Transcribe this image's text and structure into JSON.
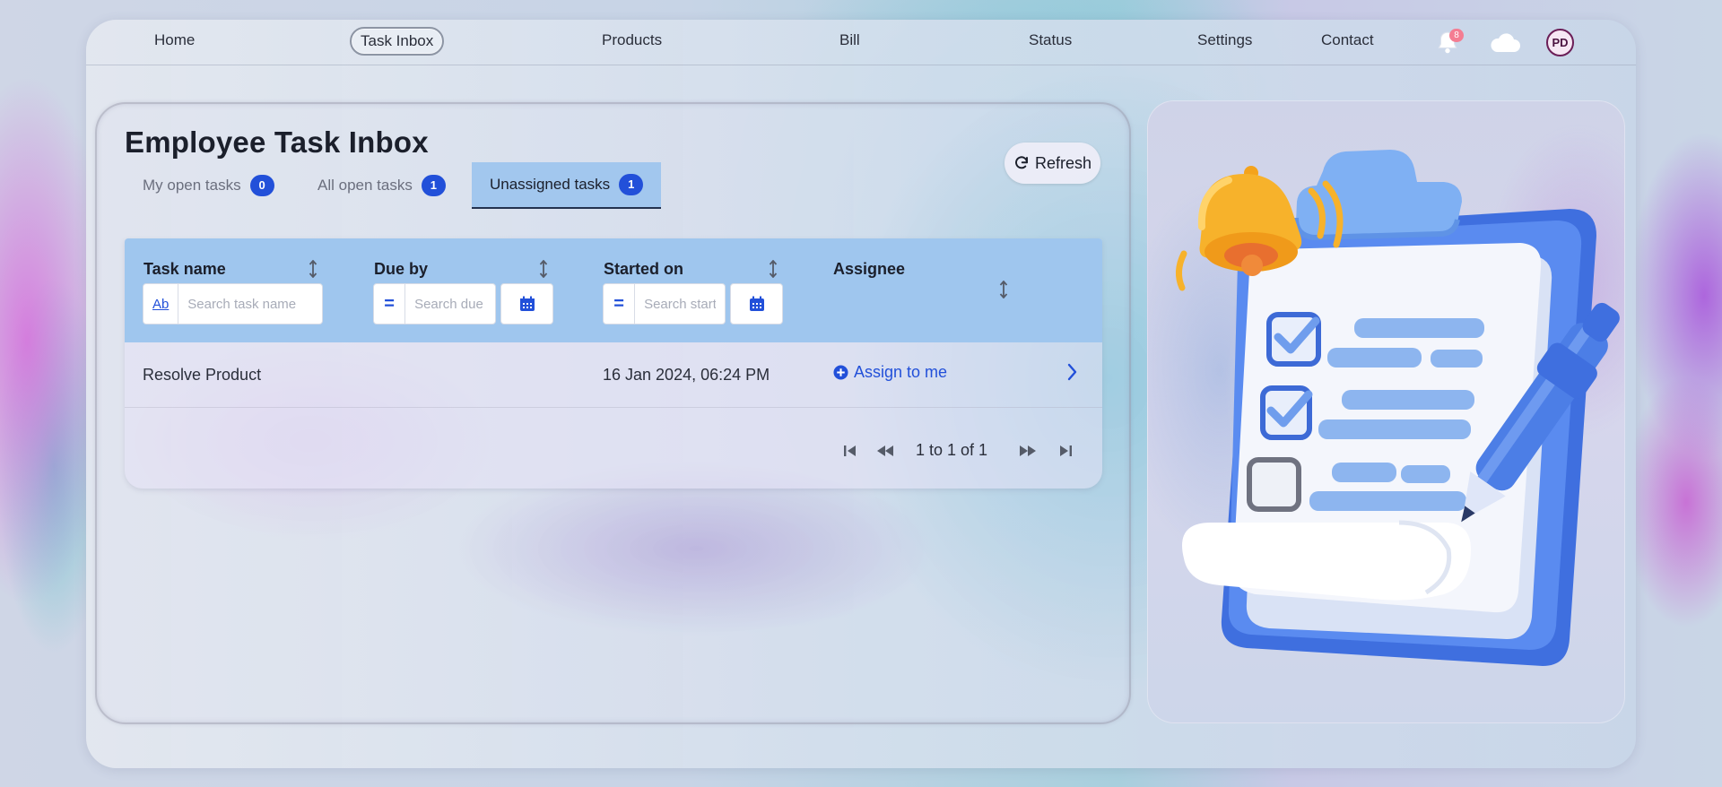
{
  "nav": {
    "links": [
      "Home",
      "Task Inbox",
      "Products",
      "Bill",
      "Status",
      "Settings",
      "Contact"
    ],
    "active_index": 1,
    "notification_count": "8",
    "avatar_initials": "PD",
    "icons": [
      "bell-icon",
      "cloud-icon"
    ]
  },
  "inbox": {
    "title": "Employee Task Inbox",
    "refresh_label": "Refresh",
    "tabs": [
      {
        "label": "My open tasks",
        "count": "0"
      },
      {
        "label": "All open tasks",
        "count": "1"
      },
      {
        "label": "Unassigned tasks",
        "count": "1"
      }
    ],
    "active_tab": 2,
    "columns": [
      {
        "title": "Task name",
        "filter_type": "Ab",
        "placeholder": "Search task name"
      },
      {
        "title": "Due by",
        "filter_type": "=",
        "placeholder": "Search due by"
      },
      {
        "title": "Started on",
        "filter_type": "=",
        "placeholder": "Search started on"
      },
      {
        "title": "Assignee"
      }
    ],
    "rows": [
      {
        "task_name": "Resolve Product",
        "due_by": "",
        "started_on": "16 Jan 2024, 06:24 PM",
        "assignee_action": "Assign to me"
      }
    ],
    "pager": {
      "text": "1 to 1 of 1"
    }
  },
  "colors": {
    "accent": "#2250d9",
    "header_bg": "#9fc6ee",
    "notif_badge": "#f47d92"
  }
}
